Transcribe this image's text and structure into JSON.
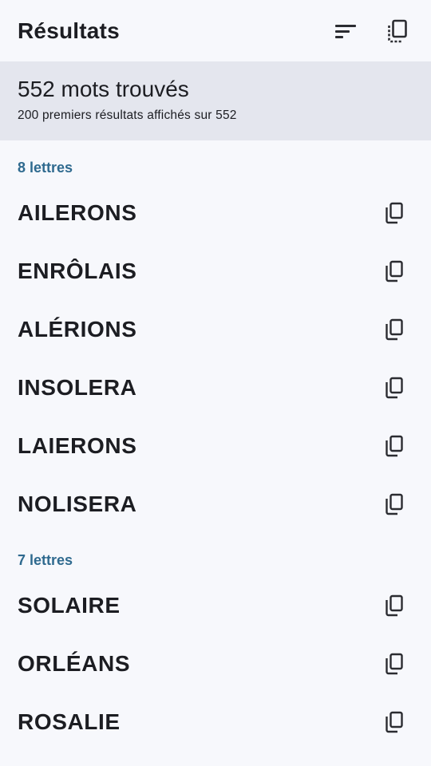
{
  "app_bar": {
    "title": "Résultats",
    "sort_icon": "sort-icon",
    "copy_all_icon": "copy-all-icon"
  },
  "summary": {
    "count": "552 mots trouvés",
    "subtitle": "200 premiers résultats affichés sur 552"
  },
  "sections": [
    {
      "header": "8 lettres",
      "words": [
        "AILERONS",
        "ENRÔLAIS",
        "ALÉRIONS",
        "INSOLERA",
        "LAIERONS",
        "NOLISERA"
      ]
    },
    {
      "header": "7 lettres",
      "words": [
        "SOLAIRE",
        "ORLÉANS",
        "ROSALIE"
      ]
    }
  ],
  "colors": {
    "background": "#f7f8fc",
    "summary_background": "#e4e6ee",
    "section_header": "#2f6a8f",
    "text": "#1c1d22"
  }
}
